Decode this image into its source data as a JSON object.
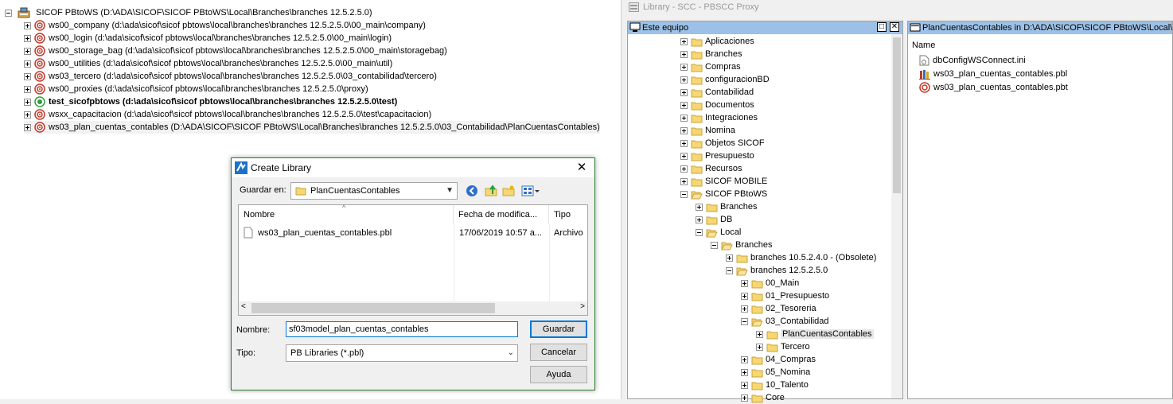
{
  "workspace": {
    "root": "SICOF PBtoWS (D:\\ADA\\SICOF\\SICOF PBtoWS\\Local\\Branches\\branches 12.5.2.5.0)",
    "targets": [
      {
        "label": "ws00_company (d:\\ada\\sicof\\sicof pbtows\\local\\branches\\branches 12.5.2.5.0\\00_main\\company)",
        "bold": false
      },
      {
        "label": "ws00_login (d:\\ada\\sicof\\sicof pbtows\\local\\branches\\branches 12.5.2.5.0\\00_main\\login)",
        "bold": false
      },
      {
        "label": "ws00_storage_bag (d:\\ada\\sicof\\sicof pbtows\\local\\branches\\branches 12.5.2.5.0\\00_main\\storagebag)",
        "bold": false
      },
      {
        "label": "ws00_utilities (d:\\ada\\sicof\\sicof pbtows\\local\\branches\\branches 12.5.2.5.0\\00_main\\util)",
        "bold": false
      },
      {
        "label": "ws03_tercero (d:\\ada\\sicof\\sicof pbtows\\local\\branches\\branches 12.5.2.5.0\\03_contabilidad\\tercero)",
        "bold": false
      },
      {
        "label": "ws00_proxies (d:\\ada\\sicof\\sicof pbtows\\local\\branches\\branches 12.5.2.5.0\\proxy)",
        "bold": false
      },
      {
        "label": "test_sicofpbtows (d:\\ada\\sicof\\sicof pbtows\\local\\branches\\branches 12.5.2.5.0\\test)",
        "bold": true
      },
      {
        "label": "wsxx_capacitacion (d:\\ada\\sicof\\sicof pbtows\\local\\branches\\branches 12.5.2.5.0\\test\\capacitacion)",
        "bold": false
      },
      {
        "label": "ws03_plan_cuentas_contables (D:\\ADA\\SICOF\\SICOF PBtoWS\\Local\\Branches\\branches 12.5.2.5.0\\03_Contabilidad\\PlanCuentasContables)",
        "bold": false
      }
    ]
  },
  "library": {
    "window_title": "Library  -  SCC - PBSCC Proxy",
    "tree_header": "Este equipo",
    "tree": [
      {
        "label": "Aplicaciones",
        "level": 0,
        "open": false
      },
      {
        "label": "Branches",
        "level": 0,
        "open": false
      },
      {
        "label": "Compras",
        "level": 0,
        "open": false
      },
      {
        "label": "configuracionBD",
        "level": 0,
        "open": false
      },
      {
        "label": "Contabilidad",
        "level": 0,
        "open": false
      },
      {
        "label": "Documentos",
        "level": 0,
        "open": false
      },
      {
        "label": "Integraciones",
        "level": 0,
        "open": false
      },
      {
        "label": "Nomina",
        "level": 0,
        "open": false
      },
      {
        "label": "Objetos SICOF",
        "level": 0,
        "open": false
      },
      {
        "label": "Presupuesto",
        "level": 0,
        "open": false
      },
      {
        "label": "Recursos",
        "level": 0,
        "open": false
      },
      {
        "label": "SICOF MOBILE",
        "level": 0,
        "open": false
      },
      {
        "label": "SICOF PBtoWS",
        "level": 0,
        "open": true
      },
      {
        "label": "Branches",
        "level": 1,
        "open": false
      },
      {
        "label": "DB",
        "level": 1,
        "open": false
      },
      {
        "label": "Local",
        "level": 1,
        "open": true
      },
      {
        "label": "Branches",
        "level": 2,
        "open": true
      },
      {
        "label": "branches 10.5.2.4.0 - (Obsolete)",
        "level": 3,
        "open": false
      },
      {
        "label": "branches 12.5.2.5.0",
        "level": 3,
        "open": true
      },
      {
        "label": "00_Main",
        "level": 4,
        "open": false
      },
      {
        "label": "01_Presupuesto",
        "level": 4,
        "open": false
      },
      {
        "label": "02_Tesoreria",
        "level": 4,
        "open": false
      },
      {
        "label": "03_Contabilidad",
        "level": 4,
        "open": true
      },
      {
        "label": "PlanCuentasContables",
        "level": 5,
        "open": false,
        "selected": true
      },
      {
        "label": "Tercero",
        "level": 5,
        "open": false
      },
      {
        "label": "04_Compras",
        "level": 4,
        "open": false
      },
      {
        "label": "05_Nomina",
        "level": 4,
        "open": false
      },
      {
        "label": "10_Talento",
        "level": 4,
        "open": false
      },
      {
        "label": "Core",
        "level": 4,
        "open": false
      }
    ],
    "list_header": "PlanCuentasContables in D:\\ADA\\SICOF\\SICOF PBtoWS\\Local\\Branches\\b",
    "list_column": "Name",
    "list_items": [
      {
        "label": "dbConfigWSConnect.ini",
        "icon": "ini-file-icon"
      },
      {
        "label": "ws03_plan_cuentas_contables.pbl",
        "icon": "pbl-library-icon"
      },
      {
        "label": "ws03_plan_cuentas_contables.pbt",
        "icon": "pbt-target-icon"
      }
    ]
  },
  "dialog": {
    "title": "Create Library",
    "save_in_label": "Guardar en:",
    "save_in_value": "PlanCuentasContables",
    "columns": {
      "name": "Nombre",
      "date": "Fecha de modifica...",
      "type": "Tipo"
    },
    "files": [
      {
        "name": "ws03_plan_cuentas_contables.pbl",
        "date": "17/06/2019 10:57 a...",
        "type": "Archivo"
      }
    ],
    "filename_label": "Nombre:",
    "filename_value": "sf03model_plan_cuentas_contables",
    "filetype_label": "Tipo:",
    "filetype_value": "PB Libraries (*.pbl)",
    "save_button": "Guardar",
    "cancel_button": "Cancelar",
    "help_button": "Ayuda"
  },
  "colors": {
    "panel_header": "#9dc1e6",
    "dialog_border": "#2f7d32",
    "focus_border": "#0078d7",
    "target_icon_red": "#c0392b",
    "target_icon_green": "#2e9e3e"
  }
}
